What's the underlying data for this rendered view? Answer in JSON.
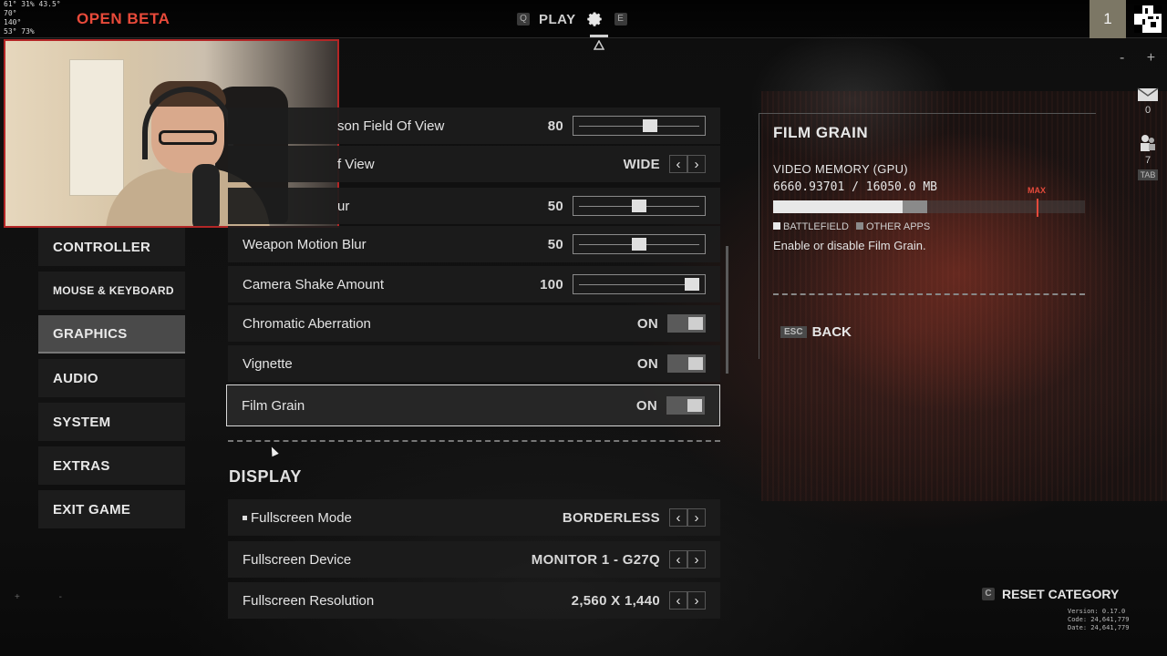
{
  "hud": {
    "lines": [
      "61°  31%  43.5°",
      "70°",
      "140°",
      "53°  73%"
    ]
  },
  "header": {
    "badge": "OPEN BETA",
    "left_key": "Q",
    "play_label": "PLAY",
    "right_key": "E",
    "player_number": "1"
  },
  "sidebar": {
    "items": [
      {
        "label": "CONTROLLER"
      },
      {
        "label": "MOUSE & KEYBOARD"
      },
      {
        "label": "GRAPHICS"
      },
      {
        "label": "AUDIO"
      },
      {
        "label": "SYSTEM"
      },
      {
        "label": "EXTRAS"
      },
      {
        "label": "EXIT GAME"
      }
    ],
    "active": "GRAPHICS"
  },
  "settings": {
    "rows": [
      {
        "label": "First Person Field Of View",
        "visible_label": "son Field Of View",
        "value": "80",
        "control": "slider",
        "level": 0.6
      },
      {
        "label": "Vehicle Field Of View",
        "visible_label": "f View",
        "value": "WIDE",
        "control": "arrows"
      },
      {
        "label": "Motion Blur",
        "visible_label": "ur",
        "value": "50",
        "control": "slider",
        "level": 0.5
      },
      {
        "label": "Weapon Motion Blur",
        "value": "50",
        "control": "slider",
        "level": 0.5
      },
      {
        "label": "Camera Shake Amount",
        "value": "100",
        "control": "slider",
        "level": 1.0
      },
      {
        "label": "Chromatic Aberration",
        "value": "ON",
        "control": "toggle"
      },
      {
        "label": "Vignette",
        "value": "ON",
        "control": "toggle"
      },
      {
        "label": "Film Grain",
        "value": "ON",
        "control": "toggle",
        "selected": true
      }
    ],
    "display_section": "DISPLAY",
    "display_rows": [
      {
        "label": "Fullscreen Mode",
        "value": "BORDERLESS"
      },
      {
        "label": "Fullscreen Device",
        "value": "MONITOR 1 - G27Q"
      },
      {
        "label": "Fullscreen Resolution",
        "value": "2,560 X 1,440"
      }
    ]
  },
  "info_panel": {
    "title": "FILM GRAIN",
    "vram_title": "VIDEO MEMORY (GPU)",
    "vram_value": "6660.93701 / 16050.0 MB",
    "vram_used_fraction": 0.415,
    "vram_other_fraction": 0.08,
    "max_label": "MAX",
    "legend_battlefield": "BATTLEFIELD",
    "legend_other": "OTHER APPS",
    "description": "Enable or disable Film Grain.",
    "back_key": "ESC",
    "back_label": "BACK"
  },
  "side_icons": {
    "mail_count": "0",
    "friends_count": "7",
    "tab_hint": "TAB"
  },
  "footer": {
    "reset_key": "C",
    "reset_label": "RESET CATEGORY",
    "version_lines": [
      "Version: 0.17.0",
      "Code: 24,641,779",
      "Date: 24,641,779"
    ]
  },
  "colors": {
    "accent_red": "#e84a3a",
    "panel_bg": "#1c1c1c",
    "active_nav": "#4a4a4a"
  }
}
